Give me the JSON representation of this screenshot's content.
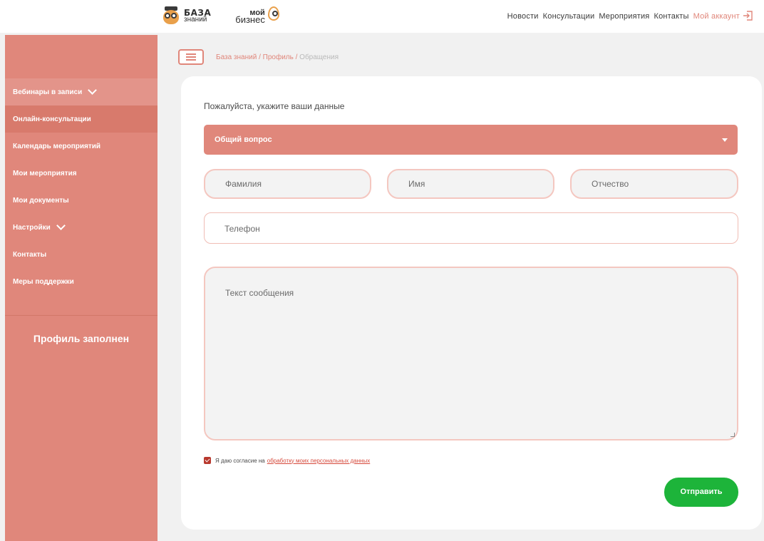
{
  "header": {
    "logo1": {
      "line1": "БАЗА",
      "line2": "знаний"
    },
    "logo2": {
      "line1": "мой",
      "line2": "бизнес"
    },
    "nav": [
      "Новости",
      "Консультации",
      "Мероприятия",
      "Контакты",
      "Мой аккаунт"
    ],
    "active_nav": "Мой аккаунт",
    "logout_icon": "logout-icon"
  },
  "sidebar": {
    "items": [
      {
        "label": "Вебинары в записи",
        "has_chevron": true
      },
      {
        "label": "Онлайн-консультации",
        "active": true
      },
      {
        "label": "Календарь мероприятий"
      },
      {
        "label": "Мои мероприятия"
      },
      {
        "label": "Мои документы"
      },
      {
        "label": "Настройки",
        "has_chevron": true
      },
      {
        "label": "Контакты"
      },
      {
        "label": "Меры поддержки"
      }
    ],
    "profile_status": "Профиль заполнен"
  },
  "breadcrumb": {
    "items": [
      "База знаний",
      "Профиль",
      "Обращения"
    ],
    "separator": "/"
  },
  "form": {
    "prompt": "Пожалуйста, укажите ваши данные",
    "topic_select": {
      "value": "Общий вопрос"
    },
    "last_name": {
      "placeholder": "Фамилия"
    },
    "first_name": {
      "placeholder": "Имя"
    },
    "middle_name": {
      "placeholder": "Отчество"
    },
    "phone": {
      "placeholder": "Телефон"
    },
    "message": {
      "placeholder": "Текст сообщения"
    },
    "consent": {
      "checked": true,
      "text": "Я даю согласие на",
      "link": "обработку моих персональных данных"
    },
    "submit_label": "Отправить"
  },
  "colors": {
    "accent": "#e0877b",
    "link": "#d6493b",
    "submit": "#1db43a",
    "checkbox": "#b8392e"
  }
}
